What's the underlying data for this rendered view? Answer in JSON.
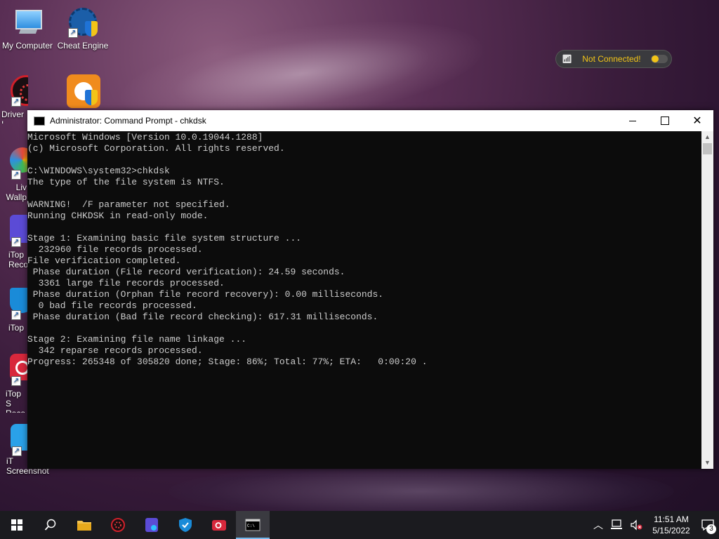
{
  "desktop": {
    "icons": [
      {
        "label": "My Computer"
      },
      {
        "label": "Cheat Engine"
      },
      {
        "label": "Driver I"
      },
      {
        "label": "Liv Wallp"
      },
      {
        "label": "iTop Reco"
      },
      {
        "label": "iTop"
      },
      {
        "label": "iTop S Reco"
      },
      {
        "label": "iT Screenshot"
      }
    ]
  },
  "status_pill": {
    "text": "Not Connected!"
  },
  "window": {
    "title": "Administrator: Command Prompt - chkdsk",
    "lines": [
      "Microsoft Windows [Version 10.0.19044.1288]",
      "(c) Microsoft Corporation. All rights reserved.",
      "",
      "C:\\WINDOWS\\system32>chkdsk",
      "The type of the file system is NTFS.",
      "",
      "WARNING!  /F parameter not specified.",
      "Running CHKDSK in read-only mode.",
      "",
      "Stage 1: Examining basic file system structure ...",
      "  232960 file records processed.",
      "File verification completed.",
      " Phase duration (File record verification): 24.59 seconds.",
      "  3361 large file records processed.",
      " Phase duration (Orphan file record recovery): 0.00 milliseconds.",
      "  0 bad file records processed.",
      " Phase duration (Bad file record checking): 617.31 milliseconds.",
      "",
      "Stage 2: Examining file name linkage ...",
      "  342 reparse records processed.",
      "Progress: 265348 of 305820 done; Stage: 86%; Total: 77%; ETA:   0:00:20 ."
    ]
  },
  "taskbar": {
    "time": "11:51 AM",
    "date": "5/15/2022",
    "notification_count": "3"
  },
  "colors": {
    "console_bg": "#0c0c0c",
    "console_text": "#cccccc",
    "taskbar_bg": "#1b1b1f",
    "accent": "#76b9ed",
    "status_yellow": "#f2c418"
  }
}
